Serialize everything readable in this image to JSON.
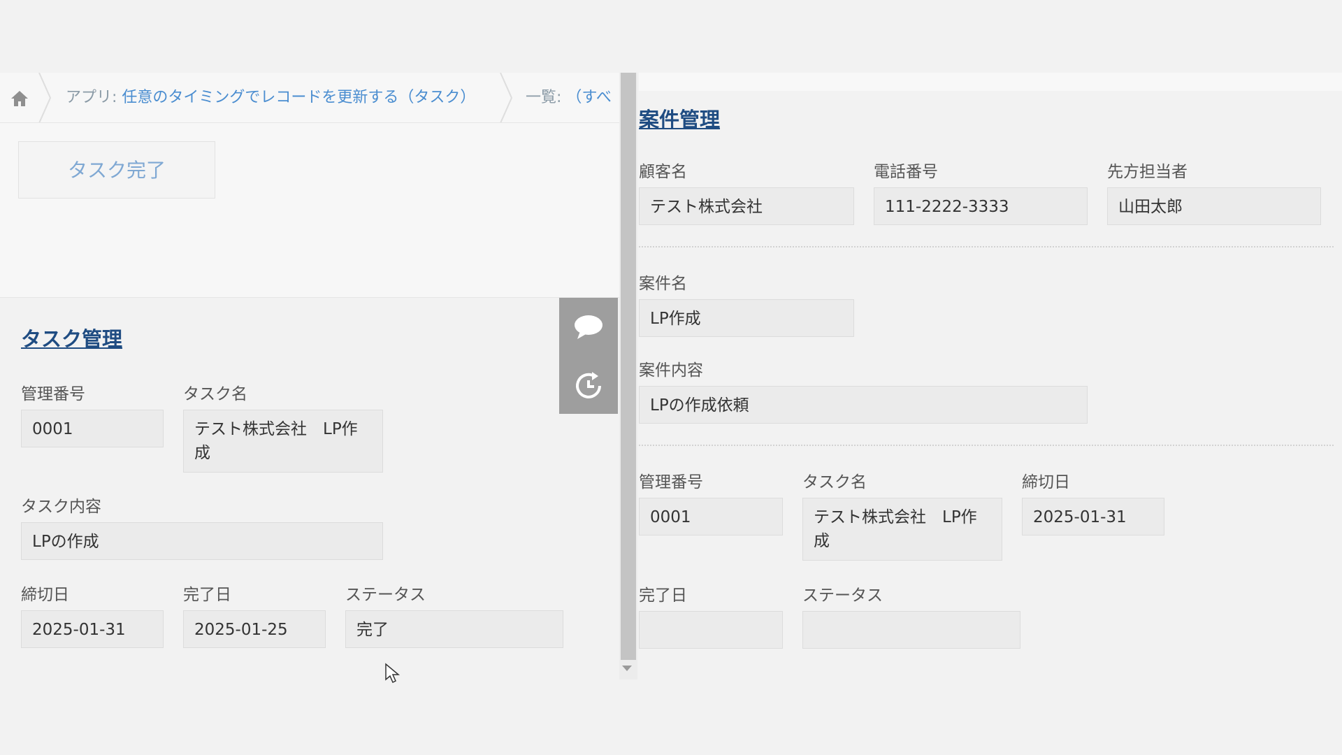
{
  "breadcrumb": {
    "app_prefix": "アプリ: ",
    "app_name": "任意のタイミングでレコードを更新する（タスク）",
    "view_prefix": "一覧: ",
    "view_name": "（すべ"
  },
  "toolbar": {
    "task_complete_label": "タスク完了"
  },
  "left": {
    "title": "タスク管理",
    "labels": {
      "id": "管理番号",
      "task_name": "タスク名",
      "task_content": "タスク内容",
      "deadline": "締切日",
      "completed": "完了日",
      "status": "ステータス"
    },
    "values": {
      "id": "0001",
      "task_name": "テスト株式会社　LP作成",
      "task_content": "LPの作成",
      "deadline": "2025-01-31",
      "completed": "2025-01-25",
      "status": "完了"
    }
  },
  "right": {
    "title": "案件管理",
    "labels": {
      "customer": "顧客名",
      "phone": "電話番号",
      "contact": "先方担当者",
      "project_name": "案件名",
      "project_content": "案件内容",
      "id": "管理番号",
      "task_name": "タスク名",
      "deadline": "締切日",
      "completed": "完了日",
      "status": "ステータス"
    },
    "values": {
      "customer": "テスト株式会社",
      "phone": "111-2222-3333",
      "contact": "山田太郎",
      "project_name": "LP作成",
      "project_content": "LPの作成依頼",
      "id": "0001",
      "task_name": "テスト株式会社　LP作成",
      "deadline": "2025-01-31",
      "completed": "",
      "status": ""
    }
  },
  "icons": {
    "home": "home-icon",
    "comment": "comment-icon",
    "history": "history-icon",
    "cursor": "mouse-cursor-icon"
  },
  "colors": {
    "link": "#4a8dd0",
    "title": "#1f4c82",
    "tool_bg": "#9e9e9e"
  }
}
